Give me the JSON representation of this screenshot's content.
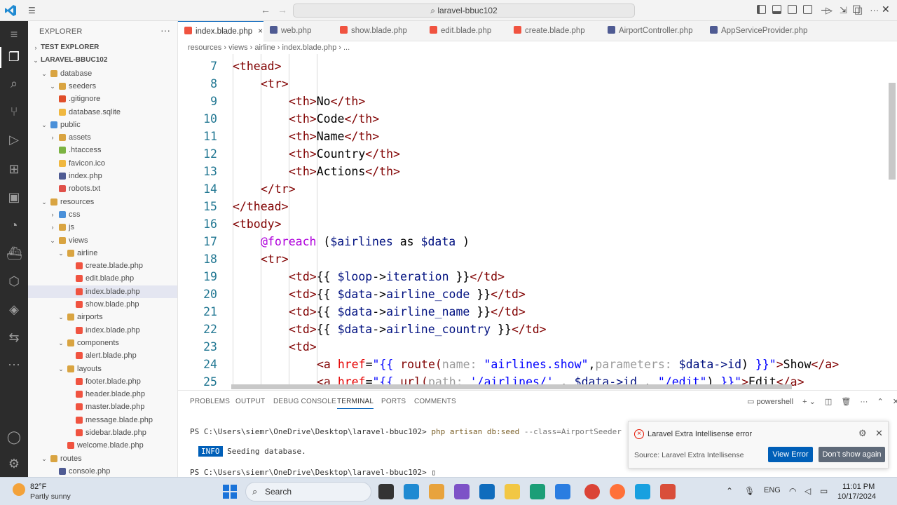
{
  "window": {
    "search_text": "laravel-bbuc102"
  },
  "explorer": {
    "header": "EXPLORER",
    "more": "···",
    "tree": [
      {
        "label": "TEST EXPLORER",
        "chev": "›",
        "indent": 0,
        "bold": true,
        "icon": "none"
      },
      {
        "label": "LARAVEL-BBUC102",
        "chev": "⌄",
        "indent": 0,
        "bold": true,
        "icon": "none"
      },
      {
        "label": "database",
        "chev": "⌄",
        "indent": 1,
        "icon": "folder"
      },
      {
        "label": "seeders",
        "chev": "⌄",
        "indent": 2,
        "icon": "folder"
      },
      {
        "label": ".gitignore",
        "chev": "",
        "indent": 2,
        "icon": "git"
      },
      {
        "label": "database.sqlite",
        "chev": "",
        "indent": 2,
        "icon": "db"
      },
      {
        "label": "public",
        "chev": "⌄",
        "indent": 1,
        "icon": "folder-blue"
      },
      {
        "label": "assets",
        "chev": "›",
        "indent": 2,
        "icon": "folder"
      },
      {
        "label": ".htaccess",
        "chev": "",
        "indent": 2,
        "icon": "ht"
      },
      {
        "label": "favicon.ico",
        "chev": "",
        "indent": 2,
        "icon": "ico"
      },
      {
        "label": "index.php",
        "chev": "",
        "indent": 2,
        "icon": "php"
      },
      {
        "label": "robots.txt",
        "chev": "",
        "indent": 2,
        "icon": "robot"
      },
      {
        "label": "resources",
        "chev": "⌄",
        "indent": 1,
        "icon": "folder"
      },
      {
        "label": "css",
        "chev": "›",
        "indent": 2,
        "icon": "folder-blue"
      },
      {
        "label": "js",
        "chev": "›",
        "indent": 2,
        "icon": "folder"
      },
      {
        "label": "views",
        "chev": "⌄",
        "indent": 2,
        "icon": "folder"
      },
      {
        "label": "airline",
        "chev": "⌄",
        "indent": 3,
        "icon": "folder"
      },
      {
        "label": "create.blade.php",
        "chev": "",
        "indent": 4,
        "icon": "blade"
      },
      {
        "label": "edit.blade.php",
        "chev": "",
        "indent": 4,
        "icon": "blade"
      },
      {
        "label": "index.blade.php",
        "chev": "",
        "indent": 4,
        "icon": "blade",
        "selected": true
      },
      {
        "label": "show.blade.php",
        "chev": "",
        "indent": 4,
        "icon": "blade"
      },
      {
        "label": "airports",
        "chev": "⌄",
        "indent": 3,
        "icon": "folder"
      },
      {
        "label": "index.blade.php",
        "chev": "",
        "indent": 4,
        "icon": "blade"
      },
      {
        "label": "components",
        "chev": "⌄",
        "indent": 3,
        "icon": "folder"
      },
      {
        "label": "alert.blade.php",
        "chev": "",
        "indent": 4,
        "icon": "blade"
      },
      {
        "label": "layouts",
        "chev": "⌄",
        "indent": 3,
        "icon": "folder"
      },
      {
        "label": "footer.blade.php",
        "chev": "",
        "indent": 4,
        "icon": "blade"
      },
      {
        "label": "header.blade.php",
        "chev": "",
        "indent": 4,
        "icon": "blade"
      },
      {
        "label": "master.blade.php",
        "chev": "",
        "indent": 4,
        "icon": "blade"
      },
      {
        "label": "message.blade.php",
        "chev": "",
        "indent": 4,
        "icon": "blade"
      },
      {
        "label": "sidebar.blade.php",
        "chev": "",
        "indent": 4,
        "icon": "blade"
      },
      {
        "label": "welcome.blade.php",
        "chev": "",
        "indent": 3,
        "icon": "blade"
      },
      {
        "label": "routes",
        "chev": "⌄",
        "indent": 1,
        "icon": "folder"
      },
      {
        "label": "console.php",
        "chev": "",
        "indent": 2,
        "icon": "php"
      }
    ]
  },
  "tabs": [
    {
      "label": "index.blade.php",
      "icon": "blade",
      "active": true,
      "close": "×"
    },
    {
      "label": "web.php",
      "icon": "php"
    },
    {
      "label": "show.blade.php",
      "icon": "blade"
    },
    {
      "label": "edit.blade.php",
      "icon": "blade"
    },
    {
      "label": "create.blade.php",
      "icon": "blade"
    },
    {
      "label": "AirportController.php",
      "icon": "php"
    },
    {
      "label": "AppServiceProvider.php",
      "icon": "php"
    }
  ],
  "breadcrumb": [
    "resources",
    "views",
    "airline",
    "index.blade.php",
    "..."
  ],
  "code": [
    {
      "n": "7",
      "indent": 1,
      "tokens": [
        [
          "tg",
          "<thead>"
        ]
      ]
    },
    {
      "n": "8",
      "indent": 2,
      "tokens": [
        [
          "tg",
          "<tr>"
        ]
      ]
    },
    {
      "n": "9",
      "indent": 3,
      "tokens": [
        [
          "tg",
          "<th>"
        ],
        [
          "tx",
          "No"
        ],
        [
          "tg",
          "</th>"
        ]
      ]
    },
    {
      "n": "10",
      "indent": 3,
      "tokens": [
        [
          "tg",
          "<th>"
        ],
        [
          "tx",
          "Code"
        ],
        [
          "tg",
          "</th>"
        ]
      ]
    },
    {
      "n": "11",
      "indent": 3,
      "tokens": [
        [
          "tg",
          "<th>"
        ],
        [
          "tx",
          "Name"
        ],
        [
          "tg",
          "</th>"
        ]
      ]
    },
    {
      "n": "12",
      "indent": 3,
      "tokens": [
        [
          "tg",
          "<th>"
        ],
        [
          "tx",
          "Country"
        ],
        [
          "tg",
          "</th>"
        ]
      ]
    },
    {
      "n": "13",
      "indent": 3,
      "tokens": [
        [
          "tg",
          "<th>"
        ],
        [
          "tx",
          "Actions"
        ],
        [
          "tg",
          "</th>"
        ]
      ]
    },
    {
      "n": "14",
      "indent": 2,
      "tokens": [
        [
          "tg",
          "</tr>"
        ]
      ]
    },
    {
      "n": "15",
      "indent": 1,
      "tokens": [
        [
          "tg",
          "</thead>"
        ]
      ]
    },
    {
      "n": "16",
      "indent": 1,
      "tokens": [
        [
          "tg",
          "<tbody>"
        ]
      ]
    },
    {
      "n": "17",
      "indent": 2,
      "tokens": [
        [
          "kw",
          "@foreach"
        ],
        [
          "tx",
          " ("
        ],
        [
          "vr",
          "$airlines"
        ],
        [
          "tx",
          " as "
        ],
        [
          "vr",
          "$data"
        ],
        [
          "tx",
          " )"
        ]
      ]
    },
    {
      "n": "18",
      "indent": 2,
      "tokens": [
        [
          "tg",
          "<tr>"
        ]
      ]
    },
    {
      "n": "19",
      "indent": 3,
      "tokens": [
        [
          "tg",
          "<td>"
        ],
        [
          "tx",
          "{{ "
        ],
        [
          "vr",
          "$loop"
        ],
        [
          "tx",
          "->"
        ],
        [
          "vr",
          "iteration"
        ],
        [
          "tx",
          " }}"
        ],
        [
          "tg",
          "</td>"
        ]
      ]
    },
    {
      "n": "20",
      "indent": 3,
      "tokens": [
        [
          "tg",
          "<td>"
        ],
        [
          "tx",
          "{{ "
        ],
        [
          "vr",
          "$data"
        ],
        [
          "tx",
          "->"
        ],
        [
          "vr",
          "airline_code"
        ],
        [
          "tx",
          " }}"
        ],
        [
          "tg",
          "</td>"
        ]
      ]
    },
    {
      "n": "21",
      "indent": 3,
      "tokens": [
        [
          "tg",
          "<td>"
        ],
        [
          "tx",
          "{{ "
        ],
        [
          "vr",
          "$data"
        ],
        [
          "tx",
          "->"
        ],
        [
          "vr",
          "airline_name"
        ],
        [
          "tx",
          " }}"
        ],
        [
          "tg",
          "</td>"
        ]
      ]
    },
    {
      "n": "22",
      "indent": 3,
      "tokens": [
        [
          "tg",
          "<td>"
        ],
        [
          "tx",
          "{{ "
        ],
        [
          "vr",
          "$data"
        ],
        [
          "tx",
          "->"
        ],
        [
          "vr",
          "airline_country"
        ],
        [
          "tx",
          " }}"
        ],
        [
          "tg",
          "</td>"
        ]
      ]
    },
    {
      "n": "23",
      "indent": 3,
      "tokens": [
        [
          "tg",
          "<td>"
        ]
      ]
    },
    {
      "n": "24",
      "indent": 4,
      "tokens": [
        [
          "tg",
          "<a "
        ],
        [
          "at",
          "href"
        ],
        [
          "tx",
          "="
        ],
        [
          "dr",
          "\"{{ "
        ],
        [
          "tg",
          "route("
        ],
        [
          "hn",
          "name: "
        ],
        [
          "dr",
          "\"airlines.show\""
        ],
        [
          "tx",
          ","
        ],
        [
          "hn",
          "parameters: "
        ],
        [
          "vr",
          "$data->id"
        ],
        [
          "tx",
          ") "
        ],
        [
          "dr",
          "}}\""
        ],
        [
          "tg",
          ">"
        ],
        [
          "tx",
          "Show"
        ],
        [
          "tg",
          "</a>"
        ]
      ]
    },
    {
      "n": "25",
      "indent": 4,
      "tokens": [
        [
          "tg",
          "<a "
        ],
        [
          "at",
          "href"
        ],
        [
          "tx",
          "="
        ],
        [
          "dr",
          "\"{{ "
        ],
        [
          "tg",
          "url("
        ],
        [
          "hn",
          "path: "
        ],
        [
          "dr",
          "'/airlines/'"
        ],
        [
          "tx",
          " . "
        ],
        [
          "vr",
          "$data->id"
        ],
        [
          "tx",
          " . "
        ],
        [
          "dr",
          "\"/edit\""
        ],
        [
          "tx",
          ") "
        ],
        [
          "dr",
          "}}\""
        ],
        [
          "tg",
          ">"
        ],
        [
          "tx",
          "Edit"
        ],
        [
          "tg",
          "</a>"
        ]
      ]
    }
  ],
  "panel": {
    "tabs": [
      "PROBLEMS",
      "OUTPUT",
      "DEBUG CONSOLE",
      "TERMINAL",
      "PORTS",
      "COMMENTS"
    ],
    "active_tab": "TERMINAL",
    "shell": "powershell",
    "lines": [
      {
        "prompt": "PS C:\\Users\\siemr\\OneDrive\\Desktop\\laravel-bbuc102> ",
        "cmd": "php artisan db:seed",
        "args": " --class=AirportSeeder"
      },
      {
        "badge": "INFO",
        "text": " Seeding database."
      },
      {
        "prompt": "PS C:\\Users\\siemr\\OneDrive\\Desktop\\laravel-bbuc102> ",
        "cmd": "",
        "args": ""
      }
    ]
  },
  "notification": {
    "title": "Laravel Extra Intellisense error",
    "source": "Source: Laravel Extra Intellisense",
    "primary_button": "View Error",
    "secondary_button": "Don't show again"
  },
  "taskbar": {
    "temperature": "82°F",
    "condition": "Partly sunny",
    "search_label": "Search",
    "language": "ENG",
    "time": "11:01 PM",
    "date": "10/17/2024"
  }
}
